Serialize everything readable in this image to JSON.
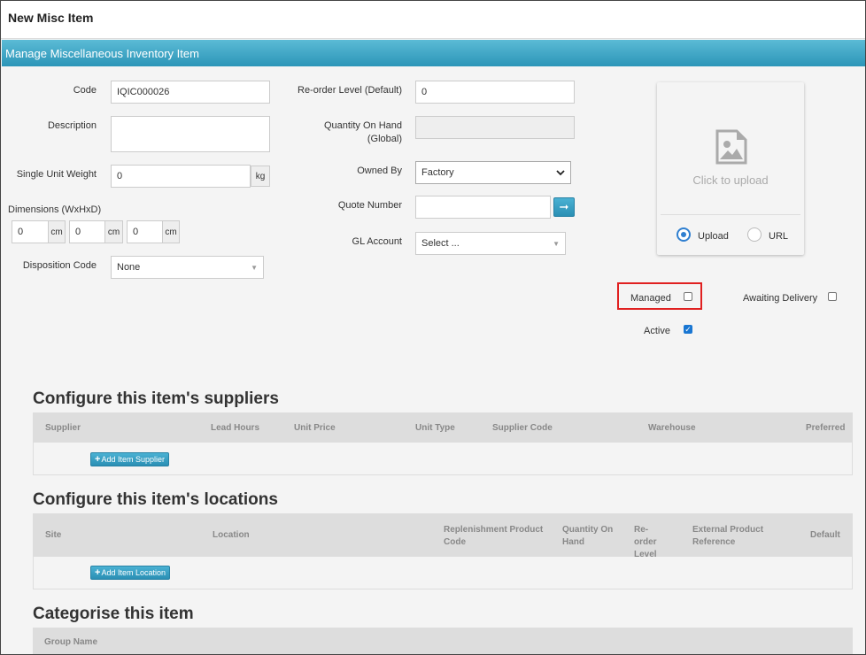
{
  "window": {
    "title": "New Misc Item"
  },
  "panel": {
    "title": "Manage Miscellaneous Inventory Item"
  },
  "form": {
    "code": {
      "label": "Code",
      "value": "IQIC000026"
    },
    "description": {
      "label": "Description",
      "value": ""
    },
    "weight": {
      "label": "Single Unit Weight",
      "value": "0",
      "unit": "kg"
    },
    "dimensions": {
      "label": "Dimensions (WxHxD)",
      "w": "0",
      "h": "0",
      "d": "0",
      "unit": "cm"
    },
    "disposition": {
      "label": "Disposition Code",
      "value": "None"
    },
    "reorder": {
      "label": "Re-order Level (Default)",
      "value": "0"
    },
    "qoh": {
      "label_line1": "Quantity On Hand",
      "label_line2": "(Global)",
      "value": ""
    },
    "owned_by": {
      "label": "Owned By",
      "value": "Factory"
    },
    "quote": {
      "label": "Quote Number",
      "value": ""
    },
    "gl": {
      "label": "GL Account",
      "value": "Select ..."
    }
  },
  "upload": {
    "prompt": "Click to upload",
    "options": [
      "Upload",
      "URL"
    ],
    "selected": "Upload"
  },
  "flags": {
    "managed": {
      "label": "Managed",
      "checked": false
    },
    "awaiting": {
      "label": "Awaiting Delivery",
      "checked": false
    },
    "active": {
      "label": "Active",
      "checked": true
    }
  },
  "suppliers": {
    "heading": "Configure this item's suppliers",
    "columns": [
      "Supplier",
      "Lead Hours",
      "Unit Price",
      "Unit Type",
      "Supplier Code",
      "Warehouse",
      "Preferred"
    ],
    "add_label": "Add Item Supplier"
  },
  "locations": {
    "heading": "Configure this item's locations",
    "columns": [
      "Site",
      "Location",
      "Replenishment Product Code",
      "Quantity On Hand",
      "Re-order Level",
      "External Product Reference",
      "Default"
    ],
    "add_label": "Add Item Location"
  },
  "categorise": {
    "heading": "Categorise this item",
    "columns": [
      "Group Name"
    ]
  },
  "colors": {
    "accent": "#2c95b8",
    "highlight": "#e02020"
  }
}
